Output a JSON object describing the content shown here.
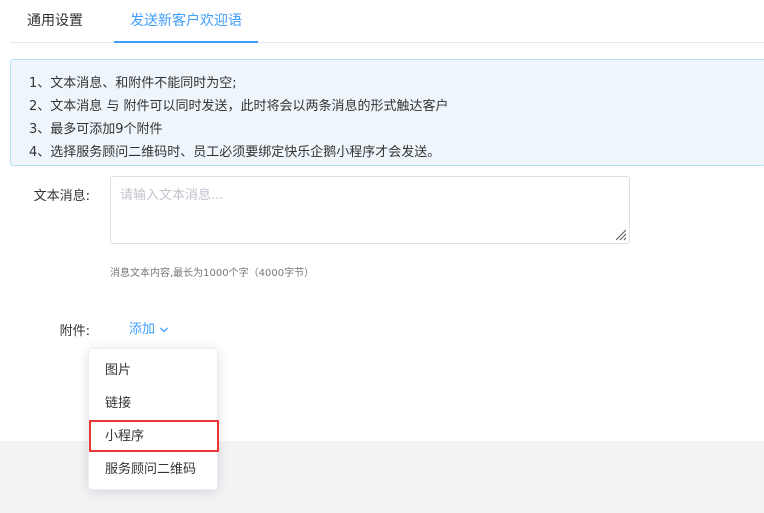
{
  "tabs": [
    {
      "label": "通用设置",
      "active": false
    },
    {
      "label": "发送新客户欢迎语",
      "active": true
    }
  ],
  "notice": [
    "1、文本消息、和附件不能同时为空;",
    "2、文本消息 与 附件可以同时发送，此时将会以两条消息的形式触达客户",
    "3、最多可添加9个附件",
    "4、选择服务顾问二维码时、员工必须要绑定快乐企鹅小程序才会发送。"
  ],
  "form": {
    "message_label": "文本消息:",
    "message_placeholder": "请输入文本消息...",
    "message_value": "",
    "message_hint": "消息文本内容,最长为1000个字（4000字节）",
    "attachment_label": "附件:",
    "add_label": "添加"
  },
  "dropdown": {
    "items": [
      "图片",
      "链接",
      "小程序",
      "服务顾问二维码"
    ],
    "highlighted_index": 2
  },
  "colors": {
    "accent": "#409eff",
    "highlight_border": "#e53935",
    "notice_bg": "#eef6fc"
  }
}
